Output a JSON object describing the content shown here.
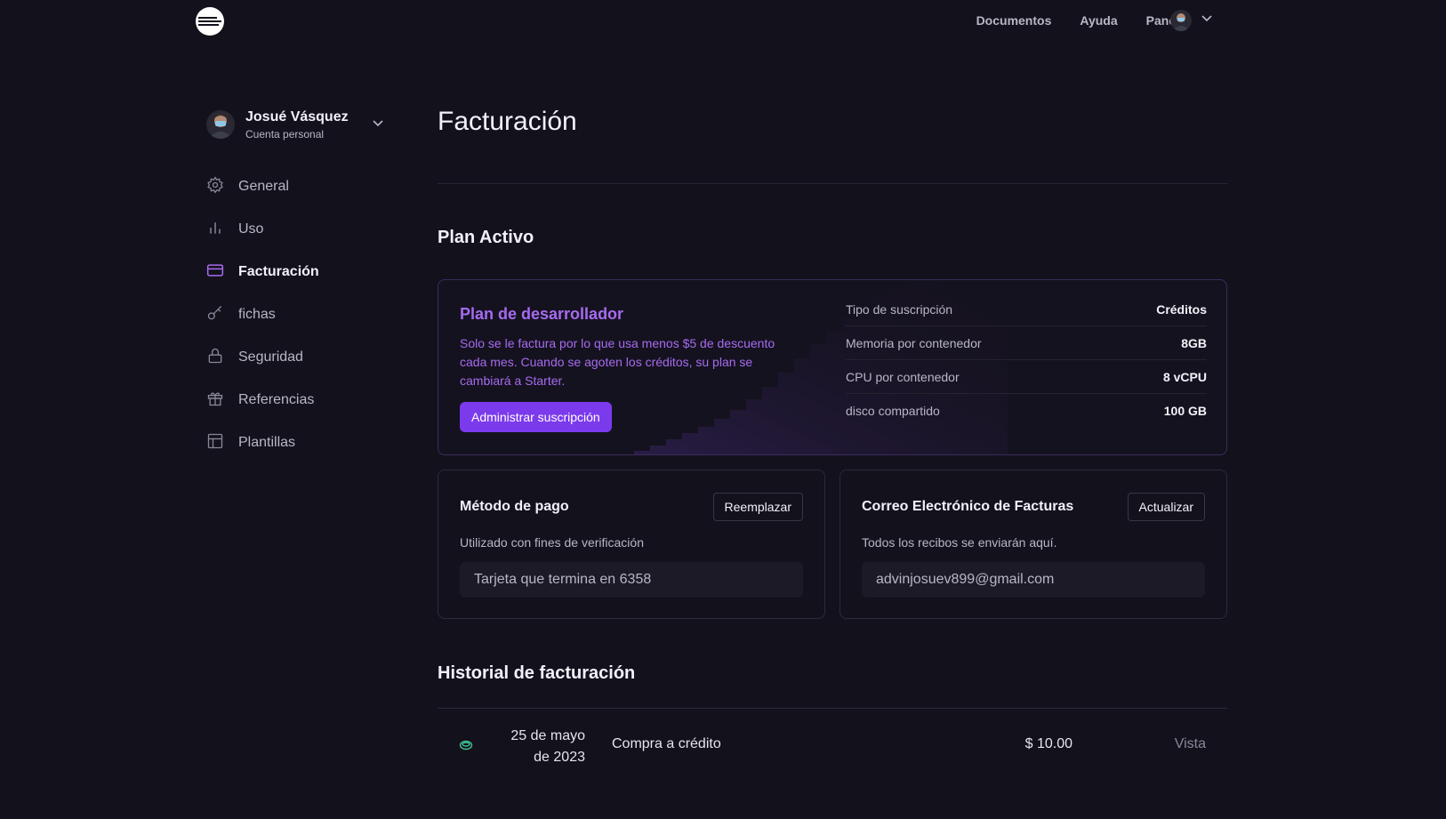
{
  "topnav": {
    "docs": "Documentos",
    "help": "Ayuda",
    "panel": "Panel"
  },
  "account": {
    "name": "Josué Vásquez",
    "type": "Cuenta personal"
  },
  "sidebar": {
    "items": [
      {
        "label": "General",
        "icon": "gear-icon"
      },
      {
        "label": "Uso",
        "icon": "bar-chart-icon"
      },
      {
        "label": "Facturación",
        "icon": "credit-card-icon",
        "active": true
      },
      {
        "label": "fichas",
        "icon": "key-icon"
      },
      {
        "label": "Seguridad",
        "icon": "lock-icon"
      },
      {
        "label": "Referencias",
        "icon": "gift-icon"
      },
      {
        "label": "Plantillas",
        "icon": "template-icon"
      }
    ]
  },
  "page": {
    "title": "Facturación"
  },
  "plan": {
    "section_title": "Plan Activo",
    "name": "Plan de desarrollador",
    "description": "Solo se le factura por lo que usa menos $5 de descuento cada mes. Cuando se agoten los créditos, su plan se cambiará a Starter.",
    "manage_button": "Administrar suscripción",
    "specs": [
      {
        "label": "Tipo de suscripción",
        "value": "Créditos"
      },
      {
        "label": "Memoria por contenedor",
        "value": "8GB"
      },
      {
        "label": "CPU por contenedor",
        "value": "8 vCPU"
      },
      {
        "label": "disco compartido",
        "value": "100 GB"
      }
    ]
  },
  "payment": {
    "title": "Método de pago",
    "button": "Reemplazar",
    "subtitle": "Utilizado con fines de verificación",
    "value": "Tarjeta que termina en 6358"
  },
  "invoice_email": {
    "title": "Correo Electrónico de Facturas",
    "button": "Actualizar",
    "subtitle": "Todos los recibos se enviarán aquí.",
    "value": "advinjosuev899@gmail.com"
  },
  "history": {
    "section_title": "Historial de facturación",
    "rows": [
      {
        "date_line1": "25 de mayo",
        "date_line2": "de 2023",
        "description": "Compra a crédito",
        "amount": "$ 10.00",
        "action": "Vista",
        "icon": "coin-icon"
      }
    ]
  },
  "colors": {
    "background": "#13111c",
    "accent": "#7c3aed",
    "accent_text": "#a66bf0",
    "success": "#3fbf8f"
  }
}
